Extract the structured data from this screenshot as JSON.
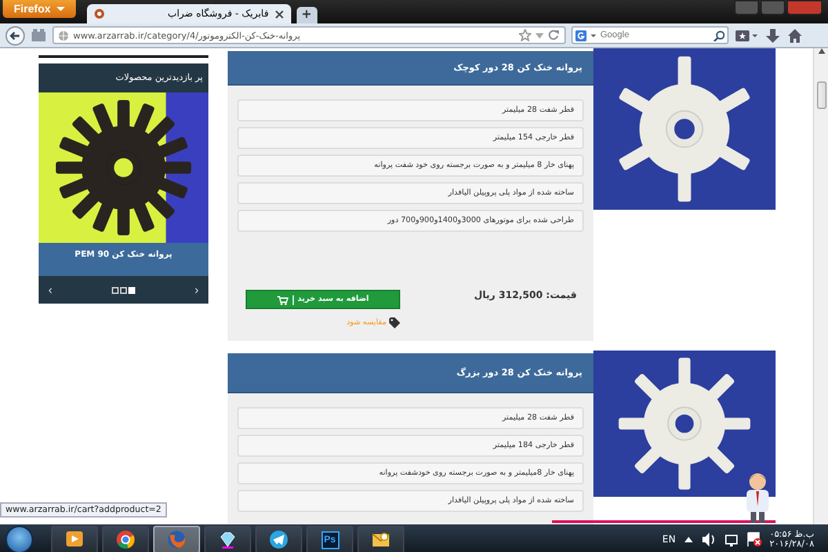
{
  "browser": {
    "menu_button": "Firefox",
    "tab": {
      "title": "فابریک - فروشگاه ضراب",
      "selected": true
    },
    "new_tab": "+",
    "url": "www.arzarrab.ir/category/4/پروانه-خنک-کن-الکتروموتور",
    "search": {
      "placeholder": "Google"
    }
  },
  "sidebar": {
    "title": "پر بازدیدترین محصولات",
    "caption": "پروانه خنک کن PEM 90",
    "prev": "‹",
    "next": "›",
    "dots": [
      {
        "selected": false
      },
      {
        "selected": false
      },
      {
        "selected": true
      }
    ]
  },
  "products": [
    {
      "title": "پروانه خنک کن 28 دور کوچک",
      "features": [
        "قطر شفت 28 میلیمتر",
        "قطر خارجی 154 میلیمتر",
        "پهنای خار 8 میلیمتر و به صورت برجسته روی خود شفت پروانه",
        "ساخته شده از مواد پلی پروپیلن الیافدار",
        "طراحی شده برای موتورهای 3000و1400و900و700 دور"
      ],
      "price": "قیمت: 312,500 ریال",
      "add_to_cart": "اضافه به سبد خرید",
      "compare": "مقایسه شود"
    },
    {
      "title": "پروانه خنک کن 28 دور بزرگ",
      "features": [
        "قطر شفت 28 میلیمتر",
        "قطر خارجی 184 میلیمتر",
        "پهنای خار 8میلیمتر و به صورت برجسته روی خودشفت پروانه",
        "ساخته شده از مواد پلی پروپیلن الیافدار"
      ]
    }
  ],
  "status_url": "www.arzarrab.ir/cart?addproduct=2",
  "taskbar": {
    "apps": [
      {
        "kind": "media",
        "selected": false
      },
      {
        "kind": "chrome",
        "selected": false
      },
      {
        "kind": "firefox",
        "selected": true
      },
      {
        "kind": "gem",
        "selected": false
      },
      {
        "kind": "telegram",
        "selected": false
      },
      {
        "kind": "photoshop",
        "label": "Ps",
        "selected": false
      },
      {
        "kind": "mail",
        "selected": false
      }
    ],
    "language": "EN",
    "time": "ب.ظ ۰۵:۵۶",
    "date": "۲۰۱۶/۲۸/۰۸"
  }
}
